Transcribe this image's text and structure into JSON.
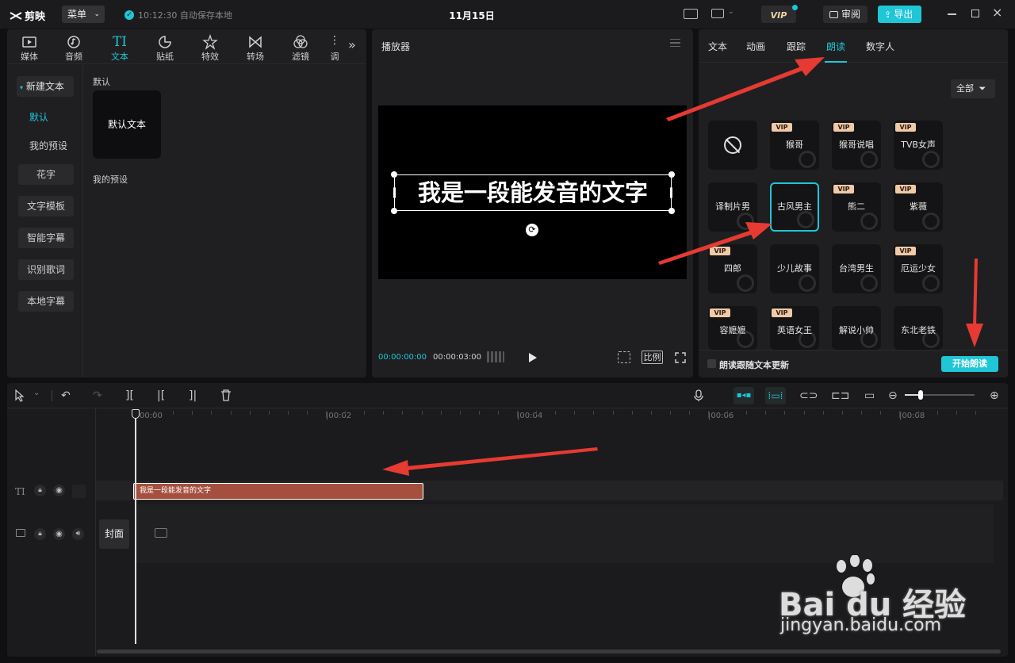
{
  "app": {
    "logo_text": "剪映",
    "menu_label": "菜单",
    "autosave_text": "10:12:30 自动保存本地",
    "title": "11月15日",
    "vip_label": "VIP",
    "review_label": "审阅",
    "export_label": "导出"
  },
  "toolbar": {
    "items": [
      {
        "label": "媒体",
        "icon": "media-icon"
      },
      {
        "label": "音频",
        "icon": "audio-icon"
      },
      {
        "label": "文本",
        "icon": "text-icon"
      },
      {
        "label": "贴纸",
        "icon": "sticker-icon"
      },
      {
        "label": "特效",
        "icon": "effects-icon"
      },
      {
        "label": "转场",
        "icon": "transition-icon"
      },
      {
        "label": "滤镜",
        "icon": "filter-icon"
      },
      {
        "label": "调",
        "icon": "adjust-icon"
      }
    ]
  },
  "left_nav": {
    "new_text": "新建文本",
    "default": "默认",
    "my_presets": "我的预设",
    "items": [
      "花字",
      "文字模板",
      "智能字幕",
      "识别歌词",
      "本地字幕"
    ]
  },
  "library": {
    "section_default": "默认",
    "default_card": "默认文本",
    "section_presets": "我的预设"
  },
  "player": {
    "title": "播放器",
    "canvas_text": "我是一段能发音的文字",
    "current_time": "00:00:00:00",
    "total_time": "00:00:03:00",
    "ratio_label": "比例"
  },
  "right_panel": {
    "tabs": [
      "文本",
      "动画",
      "跟踪",
      "朗读",
      "数字人"
    ],
    "active_tab": "朗读",
    "filter_label": "全部",
    "voices": [
      {
        "name": "",
        "vip": false,
        "type": "none"
      },
      {
        "name": "猴哥",
        "vip": true
      },
      {
        "name": "猴哥说唱",
        "vip": true
      },
      {
        "name": "TVB女声",
        "vip": true
      },
      {
        "name": "译制片男",
        "vip": false
      },
      {
        "name": "古风男主",
        "vip": false,
        "selected": true
      },
      {
        "name": "熊二",
        "vip": true
      },
      {
        "name": "紫薇",
        "vip": true
      },
      {
        "name": "四郎",
        "vip": true
      },
      {
        "name": "少儿故事",
        "vip": false
      },
      {
        "name": "台湾男生",
        "vip": false
      },
      {
        "name": "厄运少女",
        "vip": true
      },
      {
        "name": "容嬷嬷",
        "vip": true
      },
      {
        "name": "英语女王",
        "vip": true
      },
      {
        "name": "解说小帅",
        "vip": false
      },
      {
        "name": "东北老铁",
        "vip": false
      }
    ],
    "vip_badge": "VIP",
    "follow_update_label": "朗读跟随文本更新",
    "start_button": "开始朗读"
  },
  "timeline": {
    "ruler": [
      "00:00",
      "|00:02",
      "|00:04",
      "|00:06",
      "|00:08"
    ],
    "text_clip": "我是一段能发音的文字",
    "cover_label": "封面"
  },
  "watermark": {
    "brand": "Bai du 经验",
    "url": "jingyan.baidu.com"
  },
  "colors": {
    "accent": "#1fc6d6",
    "clip": "#a5503f",
    "arrow": "#e63a32"
  }
}
